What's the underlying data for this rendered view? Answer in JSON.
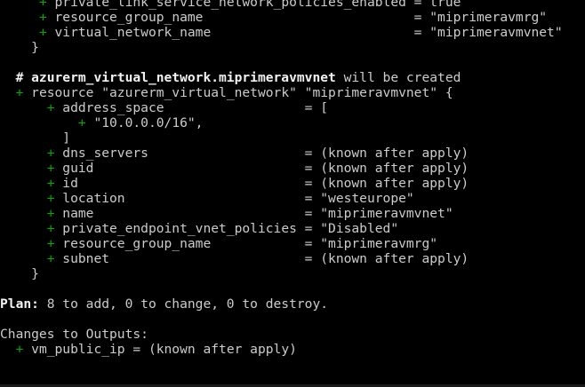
{
  "terminal": {
    "lines": [
      {
        "indent": "     ",
        "plus": "+",
        "text": " private_link_service_network_policies_enabled = true"
      },
      {
        "indent": "     ",
        "plus": "+",
        "text": " resource_group_name                           = \"miprimeravmrg\""
      },
      {
        "indent": "     ",
        "plus": "+",
        "text": " virtual_network_name                          = \"miprimeravmvnet\""
      },
      {
        "indent": "    ",
        "text": "}"
      },
      {
        "indent": "",
        "text": ""
      },
      {
        "indent": "  ",
        "bold": "# azurerm_virtual_network.miprimeravmvnet",
        "text": " will be created"
      },
      {
        "indent": "  ",
        "plus": "+",
        "text": " resource \"azurerm_virtual_network\" \"miprimeravmvnet\" {"
      },
      {
        "indent": "      ",
        "plus": "+",
        "text": " address_space                  = ["
      },
      {
        "indent": "          ",
        "plus": "+",
        "text": " \"10.0.0.0/16\","
      },
      {
        "indent": "        ",
        "text": "]"
      },
      {
        "indent": "      ",
        "plus": "+",
        "text": " dns_servers                    = (known after apply)"
      },
      {
        "indent": "      ",
        "plus": "+",
        "text": " guid                           = (known after apply)"
      },
      {
        "indent": "      ",
        "plus": "+",
        "text": " id                             = (known after apply)"
      },
      {
        "indent": "      ",
        "plus": "+",
        "text": " location                       = \"westeurope\""
      },
      {
        "indent": "      ",
        "plus": "+",
        "text": " name                           = \"miprimeravmvnet\""
      },
      {
        "indent": "      ",
        "plus": "+",
        "text": " private_endpoint_vnet_policies = \"Disabled\""
      },
      {
        "indent": "      ",
        "plus": "+",
        "text": " resource_group_name            = \"miprimeravmrg\""
      },
      {
        "indent": "      ",
        "plus": "+",
        "text": " subnet                         = (known after apply)"
      },
      {
        "indent": "    ",
        "text": "}"
      },
      {
        "indent": "",
        "text": ""
      },
      {
        "indent": "",
        "bold": "Plan:",
        "text": " 8 to add, 0 to change, 0 to destroy."
      },
      {
        "indent": "",
        "text": ""
      },
      {
        "indent": "",
        "text": "Changes to Outputs:"
      },
      {
        "indent": "  ",
        "plus": "+",
        "text": " vm_public_ip = (known after apply)"
      }
    ]
  },
  "colors": {
    "background": "#000000",
    "text": "#cccccc",
    "plus": "#13a10e",
    "bold": "#f2f2f2"
  }
}
